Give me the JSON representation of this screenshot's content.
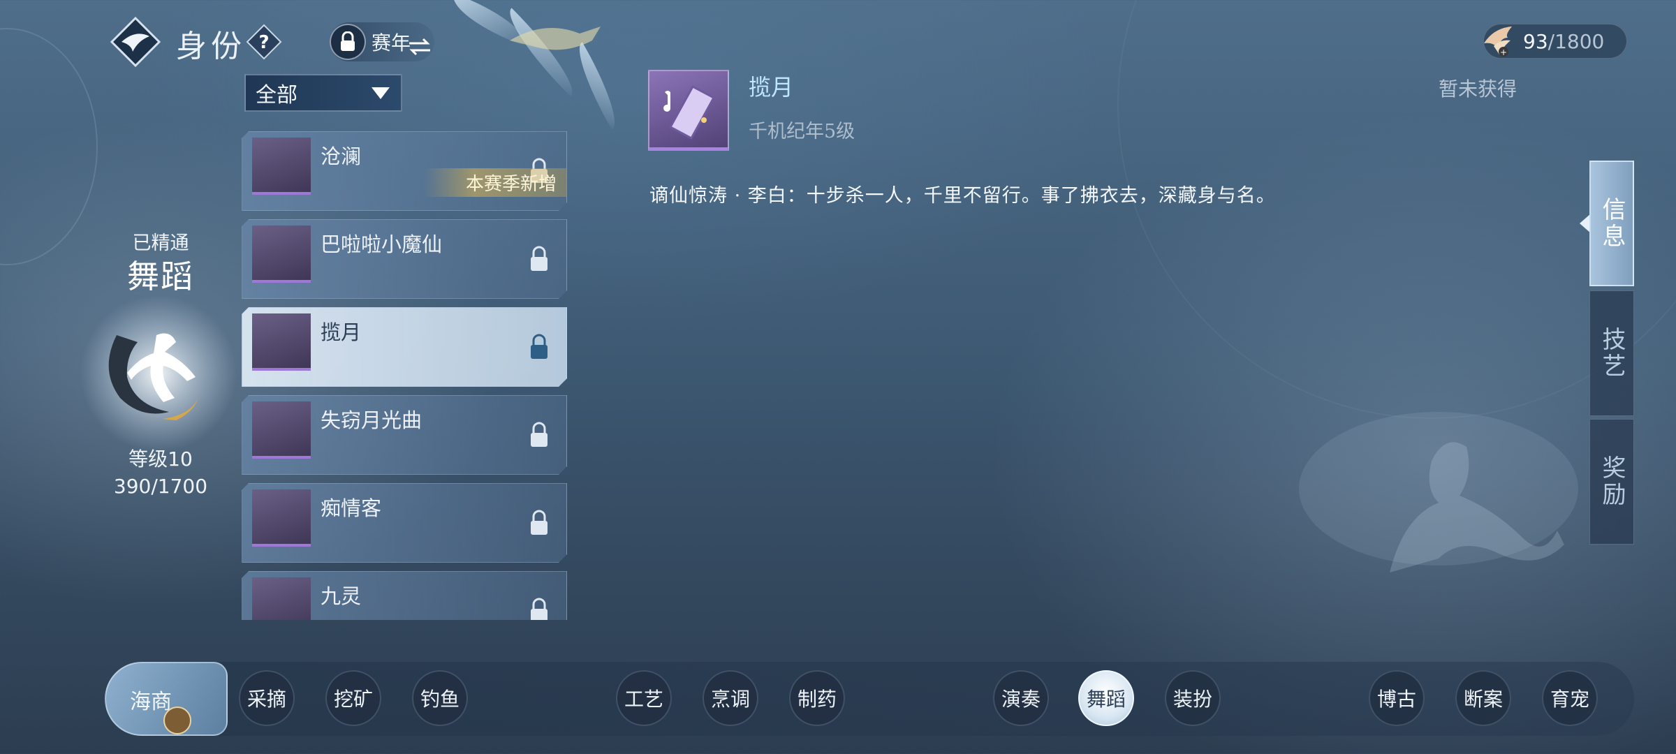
{
  "header": {
    "title": "身份",
    "help_glyph": "?",
    "season_label": "赛年",
    "currency": {
      "value": "93",
      "max": "/1800"
    }
  },
  "mastery": {
    "status": "已精通",
    "name": "舞蹈",
    "level": "等级10",
    "xp": "390/1700"
  },
  "filter": {
    "label": "全部"
  },
  "skills": [
    {
      "name": "沧澜",
      "locked": true,
      "badge": "本赛季新增"
    },
    {
      "name": "巴啦啦小魔仙",
      "locked": true
    },
    {
      "name": "揽月",
      "locked": true,
      "selected": true
    },
    {
      "name": "失窃月光曲",
      "locked": true
    },
    {
      "name": "痴情客",
      "locked": true
    },
    {
      "name": "九灵",
      "locked": true
    }
  ],
  "detail": {
    "title": "揽月",
    "requirement": "千机纪年5级",
    "status": "暂未获得",
    "description": "谪仙惊涛 · 李白：十步杀一人，千里不留行。事了拂衣去，深藏身与名。"
  },
  "side_tabs": [
    {
      "label": "信息",
      "active": true
    },
    {
      "label": "技艺",
      "active": false
    },
    {
      "label": "奖励",
      "active": false
    }
  ],
  "categories": {
    "main": "海商",
    "group1": [
      "采摘",
      "挖矿",
      "钓鱼"
    ],
    "group2": [
      "工艺",
      "烹调",
      "制药"
    ],
    "group3": [
      "演奏",
      "舞蹈",
      "装扮"
    ],
    "group4": [
      "博古",
      "断案",
      "育宠"
    ],
    "active": "舞蹈"
  },
  "colors": {
    "accent_title": "#bfe7ff",
    "selected_item": "#dce8f4",
    "new_badge": "#d8b456",
    "item_border_purple": "#9d78d6"
  },
  "icons": {
    "logo": "diamond-swallow-icon",
    "help": "question-icon",
    "season_lock": "lock-icon",
    "currency": "bird-icon",
    "item_lock": "padlock-icon",
    "dropdown": "triangle-down-icon",
    "mastery": "dancer-icon",
    "detail": "music-book-icon"
  }
}
